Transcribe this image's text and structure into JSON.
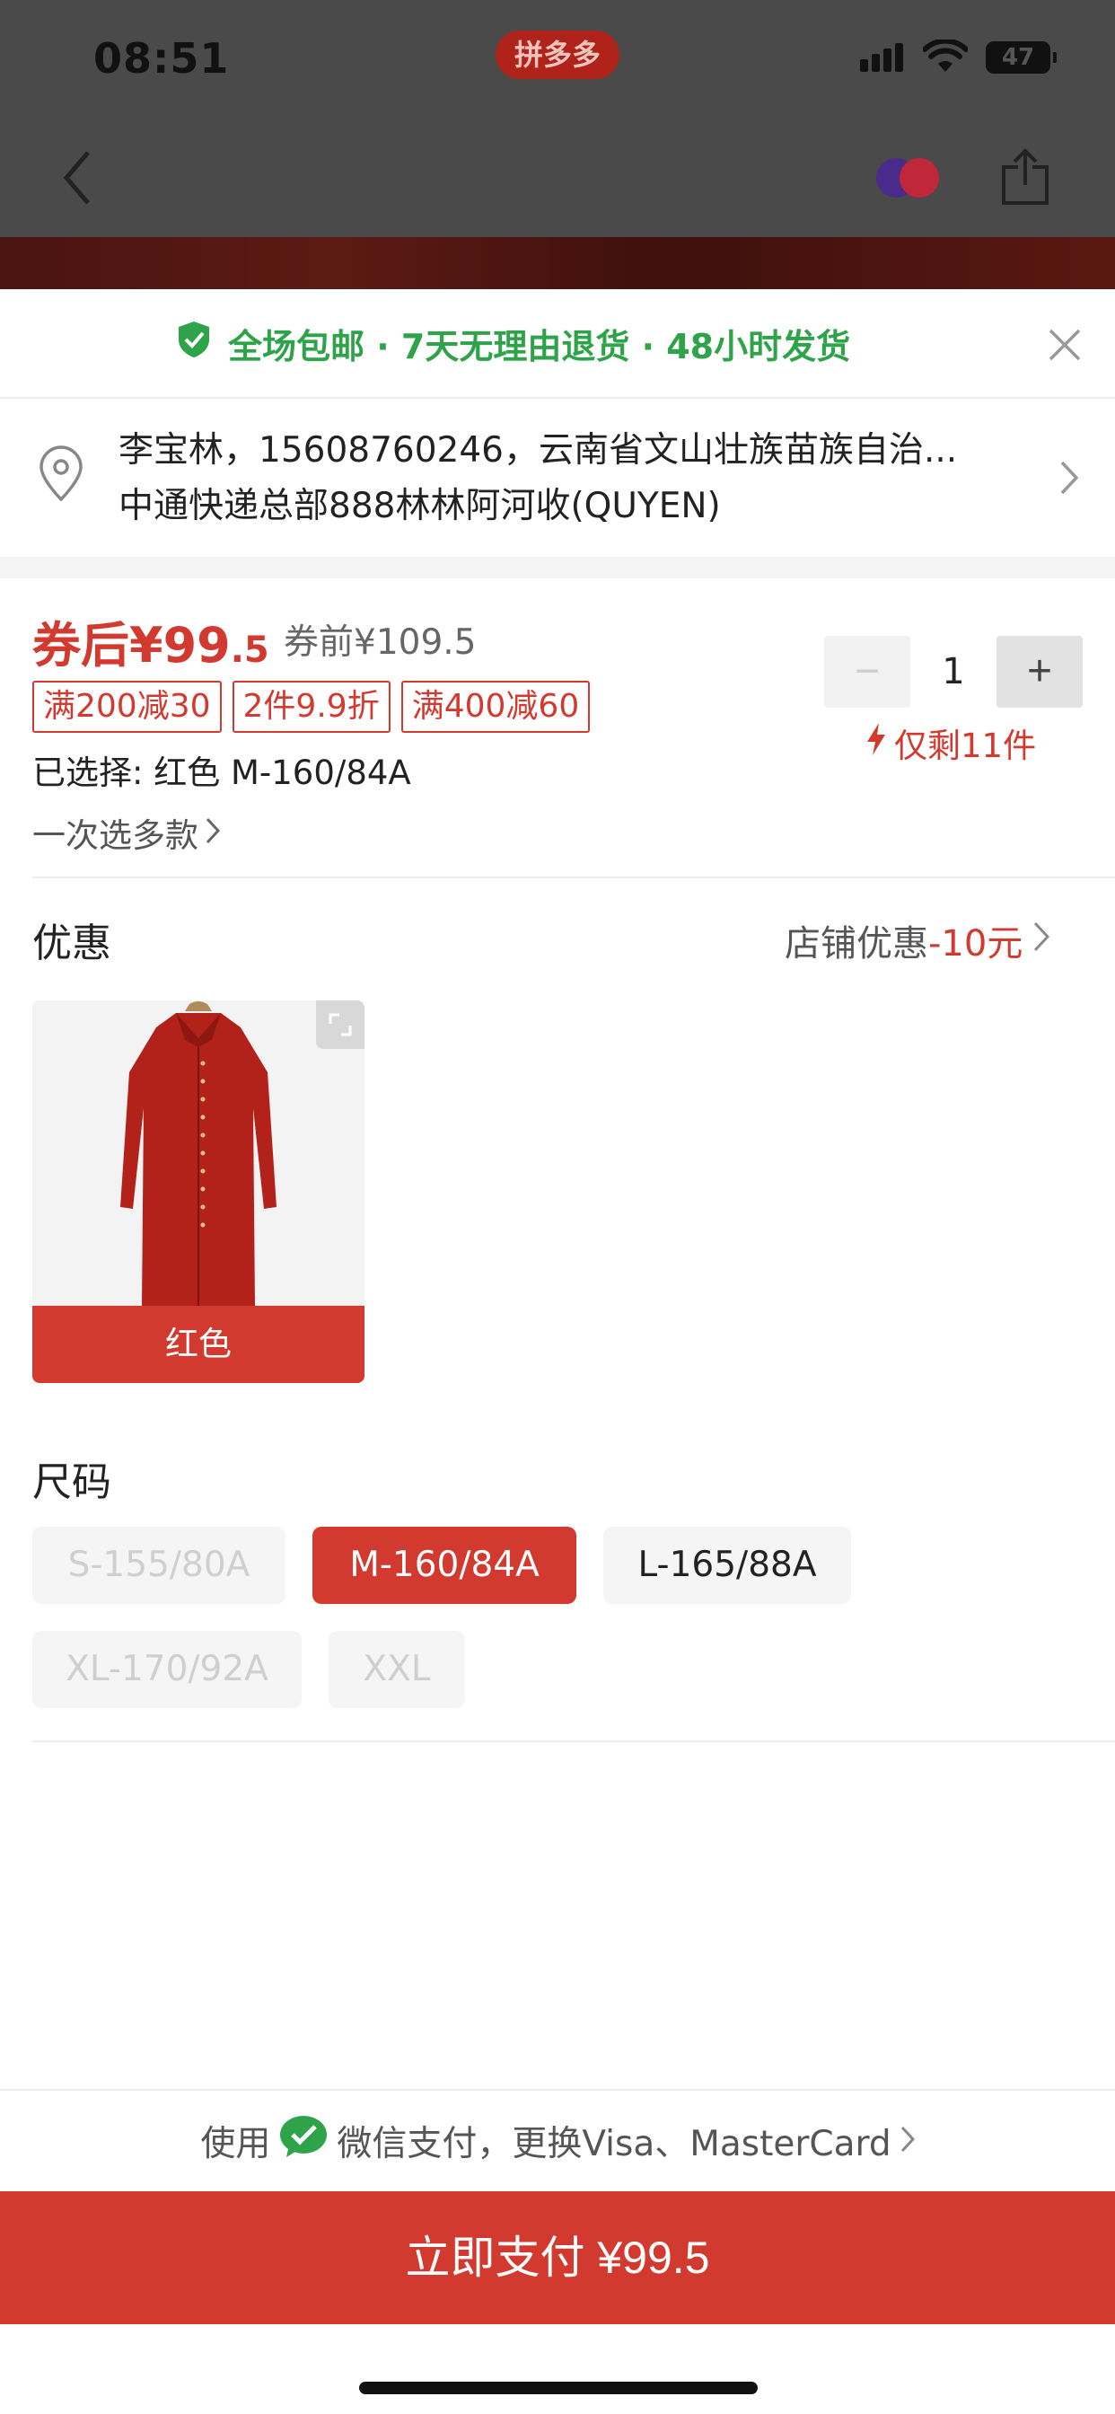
{
  "status_bar": {
    "time": "08:51",
    "app_name": "拼多多",
    "battery": "47"
  },
  "promo": {
    "text": "全场包邮 · 7天无理由退货 · 48小时发货",
    "accent_color": "#2fa34a"
  },
  "address": {
    "line1": "李宝林，15608760246，云南省文山壮族苗族自治...",
    "line2": "中通快递总部888林林阿河收(QUYEN)"
  },
  "price": {
    "after_label": "券后¥99",
    "after_decimal": ".5",
    "before": "券前¥109.5",
    "coupons": [
      "满200减30",
      "2件9.9折",
      "满400减60"
    ],
    "selected": "已选择: 红色 M-160/84A",
    "multi_select": "一次选多款"
  },
  "quantity": {
    "minus": "−",
    "value": "1",
    "plus": "+",
    "stock": "仅剩11件"
  },
  "discount": {
    "title": "优惠",
    "link_prefix": "店铺优惠",
    "link_amount": "-10元"
  },
  "color_option": {
    "label": "红色"
  },
  "size": {
    "title": "尺码",
    "options": [
      "S-155/80A",
      "M-160/84A",
      "L-165/88A",
      "XL-170/92A",
      "XXL"
    ],
    "selected": "M-160/84A",
    "disabled": [
      "S-155/80A",
      "XL-170/92A",
      "XXL"
    ]
  },
  "payment": {
    "prefix": "使用",
    "method": "微信支付，更换Visa、MasterCard",
    "button": "立即支付 ¥99.5"
  },
  "colors": {
    "brand_red": "#d33a2f",
    "wechat_green": "#2fa34a"
  }
}
